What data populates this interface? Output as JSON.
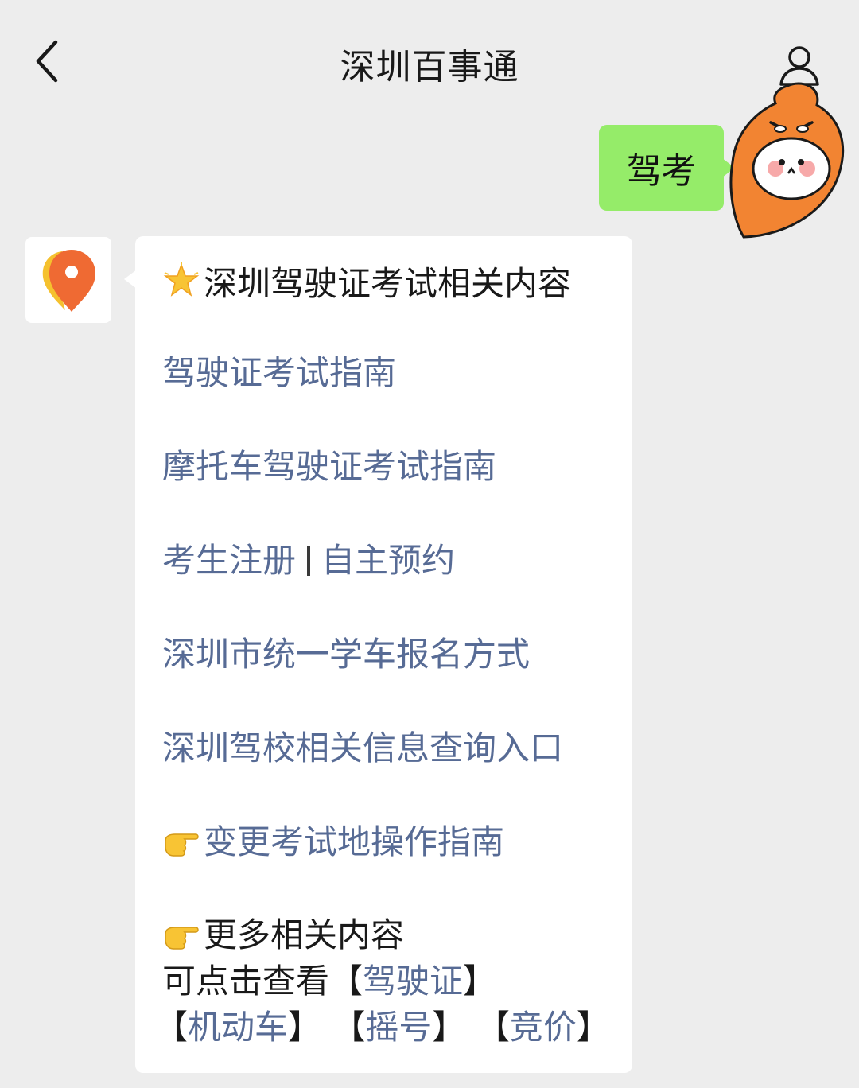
{
  "header": {
    "title": "深圳百事通"
  },
  "user_message": {
    "text": "驾考"
  },
  "bot_message": {
    "heading": "深圳驾驶证考试相关内容",
    "links": [
      "驾驶证考试指南",
      "摩托车驾驶证考试指南"
    ],
    "split_link": {
      "left": "考生注册",
      "right": "自主预约"
    },
    "links2": [
      "深圳市统一学车报名方式",
      "深圳驾校相关信息查询入口"
    ],
    "change_link": "变更考试地操作指南",
    "more": {
      "heading": "更多相关内容",
      "prefix": "可点击查看",
      "tags": [
        "驾驶证",
        "机动车",
        "摇号",
        "竞价"
      ]
    }
  },
  "icons": {
    "back": "chevron-left-icon",
    "profile": "person-icon",
    "star": "glowing-star-icon",
    "pointer": "pointing-right-hand-icon",
    "bot_avatar": "location-pin-icon"
  },
  "colors": {
    "background": "#ededed",
    "user_bubble": "#95ec69",
    "link": "#576b95",
    "bubble": "#ffffff"
  }
}
